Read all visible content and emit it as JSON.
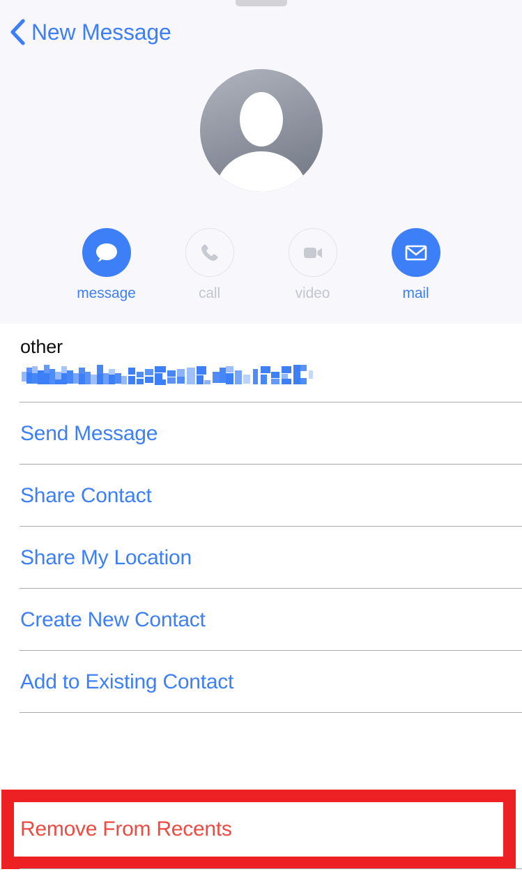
{
  "navbar": {
    "back_label": "New Message",
    "back_icon": "chevron-left-icon",
    "grabber": "sheet-grabber-handle"
  },
  "contact": {
    "avatar_icon": "person-placeholder-avatar",
    "avatar_gradient_from": "#a9adb8",
    "avatar_gradient_to": "#7d828f"
  },
  "quick_actions": [
    {
      "key": "message",
      "label": "message",
      "icon": "message-bubble-icon",
      "enabled": true
    },
    {
      "key": "call",
      "label": "call",
      "icon": "phone-icon",
      "enabled": false
    },
    {
      "key": "video",
      "label": "video",
      "icon": "video-camera-icon",
      "enabled": false
    },
    {
      "key": "mail",
      "label": "mail",
      "icon": "envelope-icon",
      "enabled": true
    }
  ],
  "email_field": {
    "label": "other",
    "value": "",
    "redacted": true,
    "redaction_style": "pixelated"
  },
  "actions": [
    {
      "key": "send-message",
      "label": "Send Message"
    },
    {
      "key": "share-contact",
      "label": "Share Contact"
    },
    {
      "key": "share-my-location",
      "label": "Share My Location"
    },
    {
      "key": "create-new-contact",
      "label": "Create New Contact"
    },
    {
      "key": "add-to-existing-contact",
      "label": "Add to Existing Contact"
    }
  ],
  "destructive": {
    "label": "Remove From Recents",
    "highlighted": true
  },
  "colors": {
    "tint_blue": "#3d7ff7",
    "destructive_red": "#ed4b42",
    "annotation_red": "#ed2024",
    "header_background": "#f7f7fc",
    "disabled_gray": "#c3c5cf",
    "divider": "#a9aab0"
  }
}
